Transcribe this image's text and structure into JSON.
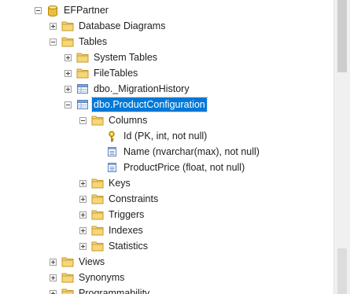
{
  "tree": {
    "items": [
      {
        "label": "EFPartner",
        "icon": "database-icon",
        "expander": "minus",
        "depth": 0
      },
      {
        "label": "Database Diagrams",
        "icon": "folder-icon",
        "expander": "plus",
        "depth": 1
      },
      {
        "label": "Tables",
        "icon": "folder-icon",
        "expander": "minus",
        "depth": 1
      },
      {
        "label": "System Tables",
        "icon": "folder-icon",
        "expander": "plus",
        "depth": 2
      },
      {
        "label": "FileTables",
        "icon": "folder-icon",
        "expander": "plus",
        "depth": 2
      },
      {
        "label": "dbo._MigrationHistory",
        "icon": "table-icon",
        "expander": "plus",
        "depth": 2
      },
      {
        "label": "dbo.ProductConfiguration",
        "icon": "table-icon",
        "expander": "minus",
        "depth": 2,
        "selected": true
      },
      {
        "label": "Columns",
        "icon": "folder-icon",
        "expander": "minus",
        "depth": 3
      },
      {
        "label": "Id (PK, int, not null)",
        "icon": "primary-key-icon",
        "expander": "none",
        "depth": 4
      },
      {
        "label": "Name (nvarchar(max), not null)",
        "icon": "column-icon",
        "expander": "none",
        "depth": 4
      },
      {
        "label": "ProductPrice (float, not null)",
        "icon": "column-icon",
        "expander": "none",
        "depth": 4
      },
      {
        "label": "Keys",
        "icon": "folder-icon",
        "expander": "plus",
        "depth": 3
      },
      {
        "label": "Constraints",
        "icon": "folder-icon",
        "expander": "plus",
        "depth": 3
      },
      {
        "label": "Triggers",
        "icon": "folder-icon",
        "expander": "plus",
        "depth": 3
      },
      {
        "label": "Indexes",
        "icon": "folder-icon",
        "expander": "plus",
        "depth": 3
      },
      {
        "label": "Statistics",
        "icon": "folder-icon",
        "expander": "plus",
        "depth": 3
      },
      {
        "label": "Views",
        "icon": "folder-icon",
        "expander": "plus",
        "depth": 1
      },
      {
        "label": "Synonyms",
        "icon": "folder-icon",
        "expander": "plus",
        "depth": 1
      },
      {
        "label": "Programmability",
        "icon": "folder-icon",
        "expander": "plus",
        "depth": 1
      }
    ]
  },
  "colors": {
    "selection": "#0078d7",
    "folder": "#dcb04a",
    "key": "#d4a017"
  }
}
